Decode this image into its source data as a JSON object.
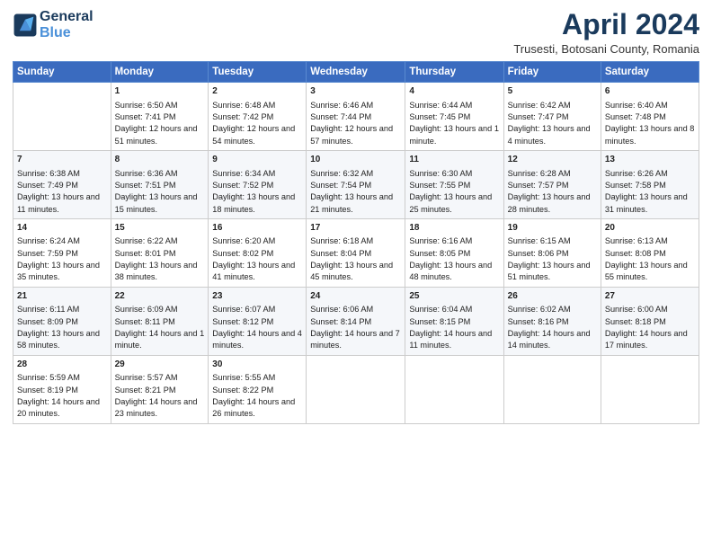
{
  "header": {
    "logo_line1": "General",
    "logo_line2": "Blue",
    "month_year": "April 2024",
    "location": "Trusesti, Botosani County, Romania"
  },
  "weekdays": [
    "Sunday",
    "Monday",
    "Tuesday",
    "Wednesday",
    "Thursday",
    "Friday",
    "Saturday"
  ],
  "weeks": [
    [
      {
        "day": "",
        "sunrise": "",
        "sunset": "",
        "daylight": ""
      },
      {
        "day": "1",
        "sunrise": "Sunrise: 6:50 AM",
        "sunset": "Sunset: 7:41 PM",
        "daylight": "Daylight: 12 hours and 51 minutes."
      },
      {
        "day": "2",
        "sunrise": "Sunrise: 6:48 AM",
        "sunset": "Sunset: 7:42 PM",
        "daylight": "Daylight: 12 hours and 54 minutes."
      },
      {
        "day": "3",
        "sunrise": "Sunrise: 6:46 AM",
        "sunset": "Sunset: 7:44 PM",
        "daylight": "Daylight: 12 hours and 57 minutes."
      },
      {
        "day": "4",
        "sunrise": "Sunrise: 6:44 AM",
        "sunset": "Sunset: 7:45 PM",
        "daylight": "Daylight: 13 hours and 1 minute."
      },
      {
        "day": "5",
        "sunrise": "Sunrise: 6:42 AM",
        "sunset": "Sunset: 7:47 PM",
        "daylight": "Daylight: 13 hours and 4 minutes."
      },
      {
        "day": "6",
        "sunrise": "Sunrise: 6:40 AM",
        "sunset": "Sunset: 7:48 PM",
        "daylight": "Daylight: 13 hours and 8 minutes."
      }
    ],
    [
      {
        "day": "7",
        "sunrise": "Sunrise: 6:38 AM",
        "sunset": "Sunset: 7:49 PM",
        "daylight": "Daylight: 13 hours and 11 minutes."
      },
      {
        "day": "8",
        "sunrise": "Sunrise: 6:36 AM",
        "sunset": "Sunset: 7:51 PM",
        "daylight": "Daylight: 13 hours and 15 minutes."
      },
      {
        "day": "9",
        "sunrise": "Sunrise: 6:34 AM",
        "sunset": "Sunset: 7:52 PM",
        "daylight": "Daylight: 13 hours and 18 minutes."
      },
      {
        "day": "10",
        "sunrise": "Sunrise: 6:32 AM",
        "sunset": "Sunset: 7:54 PM",
        "daylight": "Daylight: 13 hours and 21 minutes."
      },
      {
        "day": "11",
        "sunrise": "Sunrise: 6:30 AM",
        "sunset": "Sunset: 7:55 PM",
        "daylight": "Daylight: 13 hours and 25 minutes."
      },
      {
        "day": "12",
        "sunrise": "Sunrise: 6:28 AM",
        "sunset": "Sunset: 7:57 PM",
        "daylight": "Daylight: 13 hours and 28 minutes."
      },
      {
        "day": "13",
        "sunrise": "Sunrise: 6:26 AM",
        "sunset": "Sunset: 7:58 PM",
        "daylight": "Daylight: 13 hours and 31 minutes."
      }
    ],
    [
      {
        "day": "14",
        "sunrise": "Sunrise: 6:24 AM",
        "sunset": "Sunset: 7:59 PM",
        "daylight": "Daylight: 13 hours and 35 minutes."
      },
      {
        "day": "15",
        "sunrise": "Sunrise: 6:22 AM",
        "sunset": "Sunset: 8:01 PM",
        "daylight": "Daylight: 13 hours and 38 minutes."
      },
      {
        "day": "16",
        "sunrise": "Sunrise: 6:20 AM",
        "sunset": "Sunset: 8:02 PM",
        "daylight": "Daylight: 13 hours and 41 minutes."
      },
      {
        "day": "17",
        "sunrise": "Sunrise: 6:18 AM",
        "sunset": "Sunset: 8:04 PM",
        "daylight": "Daylight: 13 hours and 45 minutes."
      },
      {
        "day": "18",
        "sunrise": "Sunrise: 6:16 AM",
        "sunset": "Sunset: 8:05 PM",
        "daylight": "Daylight: 13 hours and 48 minutes."
      },
      {
        "day": "19",
        "sunrise": "Sunrise: 6:15 AM",
        "sunset": "Sunset: 8:06 PM",
        "daylight": "Daylight: 13 hours and 51 minutes."
      },
      {
        "day": "20",
        "sunrise": "Sunrise: 6:13 AM",
        "sunset": "Sunset: 8:08 PM",
        "daylight": "Daylight: 13 hours and 55 minutes."
      }
    ],
    [
      {
        "day": "21",
        "sunrise": "Sunrise: 6:11 AM",
        "sunset": "Sunset: 8:09 PM",
        "daylight": "Daylight: 13 hours and 58 minutes."
      },
      {
        "day": "22",
        "sunrise": "Sunrise: 6:09 AM",
        "sunset": "Sunset: 8:11 PM",
        "daylight": "Daylight: 14 hours and 1 minute."
      },
      {
        "day": "23",
        "sunrise": "Sunrise: 6:07 AM",
        "sunset": "Sunset: 8:12 PM",
        "daylight": "Daylight: 14 hours and 4 minutes."
      },
      {
        "day": "24",
        "sunrise": "Sunrise: 6:06 AM",
        "sunset": "Sunset: 8:14 PM",
        "daylight": "Daylight: 14 hours and 7 minutes."
      },
      {
        "day": "25",
        "sunrise": "Sunrise: 6:04 AM",
        "sunset": "Sunset: 8:15 PM",
        "daylight": "Daylight: 14 hours and 11 minutes."
      },
      {
        "day": "26",
        "sunrise": "Sunrise: 6:02 AM",
        "sunset": "Sunset: 8:16 PM",
        "daylight": "Daylight: 14 hours and 14 minutes."
      },
      {
        "day": "27",
        "sunrise": "Sunrise: 6:00 AM",
        "sunset": "Sunset: 8:18 PM",
        "daylight": "Daylight: 14 hours and 17 minutes."
      }
    ],
    [
      {
        "day": "28",
        "sunrise": "Sunrise: 5:59 AM",
        "sunset": "Sunset: 8:19 PM",
        "daylight": "Daylight: 14 hours and 20 minutes."
      },
      {
        "day": "29",
        "sunrise": "Sunrise: 5:57 AM",
        "sunset": "Sunset: 8:21 PM",
        "daylight": "Daylight: 14 hours and 23 minutes."
      },
      {
        "day": "30",
        "sunrise": "Sunrise: 5:55 AM",
        "sunset": "Sunset: 8:22 PM",
        "daylight": "Daylight: 14 hours and 26 minutes."
      },
      {
        "day": "",
        "sunrise": "",
        "sunset": "",
        "daylight": ""
      },
      {
        "day": "",
        "sunrise": "",
        "sunset": "",
        "daylight": ""
      },
      {
        "day": "",
        "sunrise": "",
        "sunset": "",
        "daylight": ""
      },
      {
        "day": "",
        "sunrise": "",
        "sunset": "",
        "daylight": ""
      }
    ]
  ]
}
